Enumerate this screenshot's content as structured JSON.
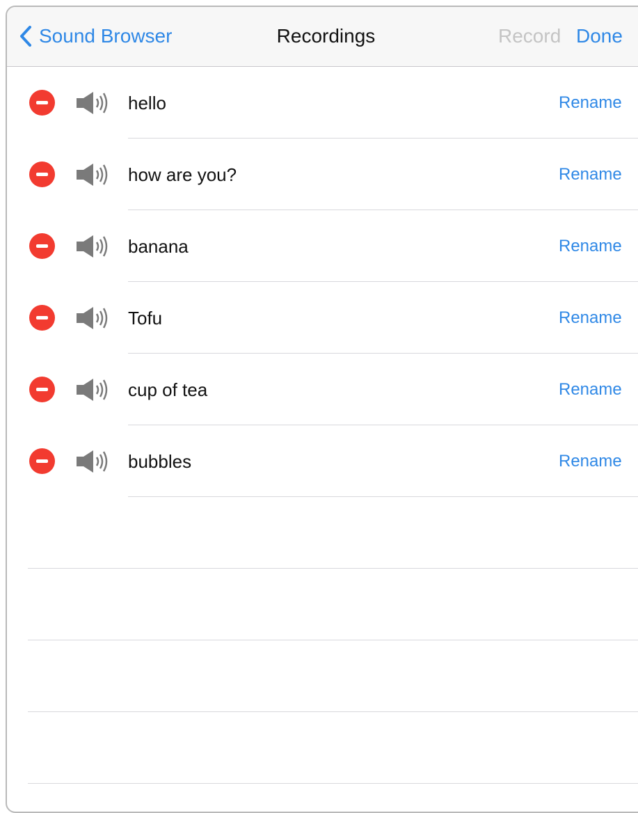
{
  "navbar": {
    "back_label": "Sound Browser",
    "title": "Recordings",
    "record_label": "Record",
    "done_label": "Done"
  },
  "recordings": [
    {
      "name": "hello",
      "rename_label": "Rename"
    },
    {
      "name": "how are you?",
      "rename_label": "Rename"
    },
    {
      "name": "banana",
      "rename_label": "Rename"
    },
    {
      "name": "Tofu",
      "rename_label": "Rename"
    },
    {
      "name": "cup of tea",
      "rename_label": "Rename"
    },
    {
      "name": "bubbles",
      "rename_label": "Rename"
    }
  ],
  "icons": {
    "back": "chevron-left-icon",
    "delete": "minus-circle-icon",
    "play": "speaker-icon"
  },
  "colors": {
    "accent": "#2f88e6",
    "delete": "#f23b30",
    "disabled": "#c4c4c4"
  }
}
